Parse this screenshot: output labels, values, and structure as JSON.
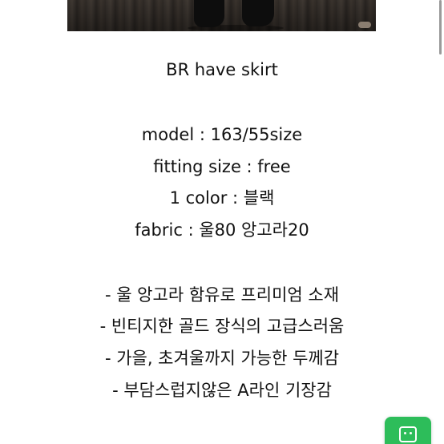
{
  "product": {
    "title": "BR have skirt"
  },
  "specs": {
    "model": "model : 163/55size",
    "fitting_size": "fitting size : free",
    "color": "1 color : 블랙",
    "fabric": "fabric : 울80 앙고라20"
  },
  "features": [
    "- 울 앙고라 함유로 프리미엄 소재",
    "- 빈티지한 골드 장식의 고급스러움",
    "- 가을, 초겨울까지 가능한 두께감",
    "- 부담스럽지않은 A라인 기장감"
  ],
  "floating_button": {
    "icon": "chat-icon",
    "color": "#2dbd5a"
  },
  "colors": {
    "background": "#ffffff",
    "text": "#111111",
    "accent": "#2dbd5a"
  }
}
